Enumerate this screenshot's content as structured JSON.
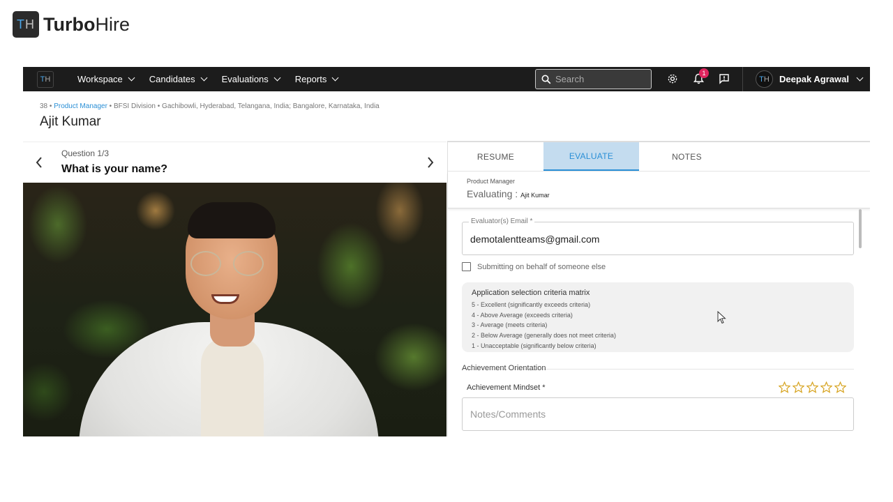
{
  "brand": {
    "logo_t": "T",
    "logo_h": "H",
    "name_bold": "Turbo",
    "name_regular": "Hire"
  },
  "topnav": {
    "logo_t": "T",
    "logo_h": "H",
    "menu": [
      {
        "label": "Workspace"
      },
      {
        "label": "Candidates"
      },
      {
        "label": "Evaluations"
      },
      {
        "label": "Reports"
      }
    ],
    "search_placeholder": "Search",
    "notification_count": "1",
    "user": {
      "avatar_t": "T",
      "avatar_h": "H",
      "name": "Deepak Agrawal"
    }
  },
  "breadcrumb": {
    "id": "38",
    "sep": " • ",
    "role": "Product Manager",
    "rest": " • BFSI Division • Gachibowli, Hyderabad, Telangana, India; Bangalore, Karnataka, India"
  },
  "candidate": {
    "name": "Ajit Kumar"
  },
  "question": {
    "number": "Question 1/3",
    "text": "What is your name?"
  },
  "panel": {
    "tabs": [
      {
        "label": "RESUME",
        "active": false
      },
      {
        "label": "EVALUATE",
        "active": true
      },
      {
        "label": "NOTES",
        "active": false
      }
    ],
    "role": "Product Manager",
    "evaluating_label": "Evaluating :",
    "evaluating_name": "Ajit Kumar",
    "email_label": "Evaluator(s) Email *",
    "email_value": "demotalentteams@gmail.com",
    "behalf_label": "Submitting on behalf of someone else",
    "matrix": {
      "title": "Application selection criteria matrix",
      "items": [
        "5 - Excellent (significantly exceeds criteria)",
        "4 - Above Average (exceeds criteria)",
        "3 - Average (meets criteria)",
        "2 - Below Average (generally does not meet criteria)",
        "1 - Unacceptable (significantly below criteria)"
      ]
    },
    "section_title": "Achievement Orientation",
    "criterion": "Achievement Mindset *",
    "rating": {
      "value": 0,
      "max": 5
    },
    "notes_placeholder": "Notes/Comments"
  },
  "colors": {
    "accent": "#2a8fd6",
    "nav_bg": "#1c1c1c",
    "tab_active_bg": "#c4dcef",
    "star": "#d6a21d",
    "badge": "#e0245e"
  }
}
